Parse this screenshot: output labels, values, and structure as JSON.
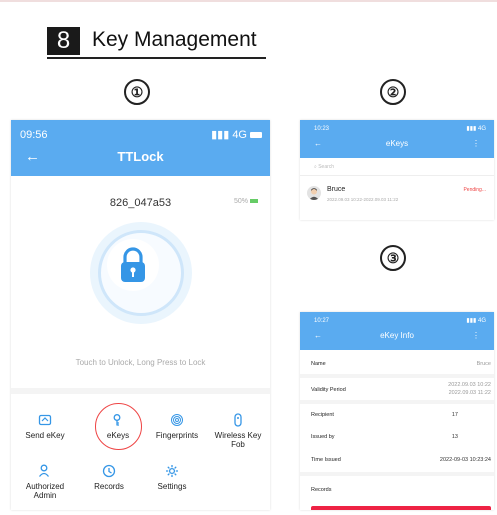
{
  "section": {
    "number": "8",
    "title": "Key Management"
  },
  "steps": [
    "①",
    "②",
    "③"
  ],
  "phone1": {
    "time": "09:56",
    "signal": "4G",
    "app_title": "TTLock",
    "lock_name": "826_047a53",
    "battery": "50%",
    "unlock_hint": "Touch to Unlock, Long Press to Lock",
    "menu": [
      {
        "label": "Send eKey",
        "icon": "send-ekey-icon"
      },
      {
        "label": "eKeys",
        "icon": "ekeys-icon"
      },
      {
        "label": "Fingerprints",
        "icon": "fingerprint-icon"
      },
      {
        "label": "Wireless Key Fob",
        "icon": "key-fob-icon"
      },
      {
        "label": "Authorized Admin",
        "icon": "admin-icon"
      },
      {
        "label": "Records",
        "icon": "records-icon"
      },
      {
        "label": "Settings",
        "icon": "settings-icon"
      }
    ],
    "accent": "#5aabf0",
    "highlight": "#e44444"
  },
  "phone2": {
    "time": "10:23",
    "signal": "4G",
    "title": "eKeys",
    "search_placeholder": "Search",
    "ekey": {
      "name": "Bruce",
      "dates": "2022.09.03 10:22-2022.09.03 11:22",
      "status": "Pending..."
    }
  },
  "phone3": {
    "time": "10:27",
    "signal": "4G",
    "title": "eKey Info",
    "rows": [
      {
        "label": "Name",
        "value": "Bruce"
      },
      {
        "label": "Validity Period",
        "value": "2022.09.03 10:22",
        "value2": "2022.09.03 11:22"
      },
      {
        "label": "Recipient",
        "value": "17"
      },
      {
        "label": "Issued by",
        "value": "13"
      },
      {
        "label": "Time Issued",
        "value": "2022-09-03 10:23:24"
      },
      {
        "label": "Records",
        "value": ""
      }
    ]
  }
}
